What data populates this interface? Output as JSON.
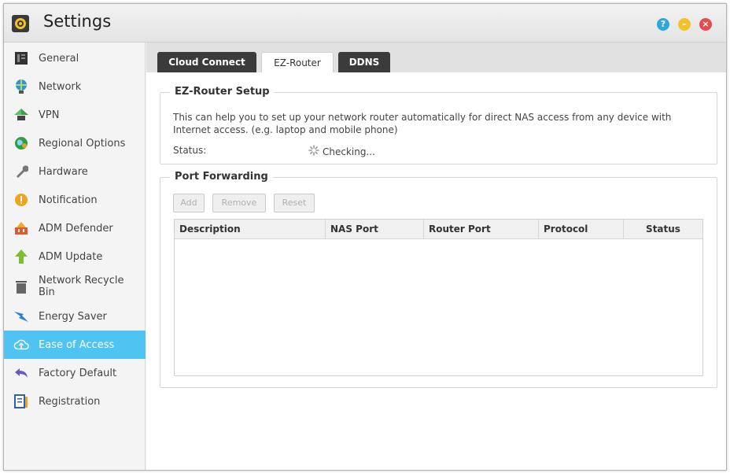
{
  "window": {
    "title": "Settings"
  },
  "window_controls": [
    "help",
    "minimize",
    "close"
  ],
  "sidebar": {
    "active_index": 10,
    "items": [
      {
        "label": "General",
        "icon": "general-icon"
      },
      {
        "label": "Network",
        "icon": "network-globe-icon"
      },
      {
        "label": "VPN",
        "icon": "vpn-icon"
      },
      {
        "label": "Regional Options",
        "icon": "regional-globe-icon"
      },
      {
        "label": "Hardware",
        "icon": "hardware-wrench-icon"
      },
      {
        "label": "Notification",
        "icon": "notification-icon"
      },
      {
        "label": "ADM Defender",
        "icon": "defender-icon"
      },
      {
        "label": "ADM Update",
        "icon": "update-arrow-icon"
      },
      {
        "label": "Network Recycle Bin",
        "icon": "recycle-bin-icon"
      },
      {
        "label": "Energy Saver",
        "icon": "energy-saver-icon"
      },
      {
        "label": "Ease of Access",
        "icon": "cloud-icon"
      },
      {
        "label": "Factory Default",
        "icon": "undo-arrow-icon"
      },
      {
        "label": "Registration",
        "icon": "registration-icon"
      }
    ]
  },
  "tabs": [
    {
      "label": "Cloud Connect"
    },
    {
      "label": "EZ-Router"
    },
    {
      "label": "DDNS"
    }
  ],
  "active_tab": "EZ-Router",
  "ez_router": {
    "legend": "EZ-Router Setup",
    "description": "This can help you to set up your network router automatically for direct NAS access from any device with Internet access. (e.g. laptop and mobile phone)",
    "status_label": "Status:",
    "status_value": "Checking..."
  },
  "port_forwarding": {
    "legend": "Port Forwarding",
    "buttons": {
      "add": "Add",
      "remove": "Remove",
      "reset": "Reset"
    },
    "columns": [
      "Description",
      "NAS Port",
      "Router Port",
      "Protocol",
      "Status"
    ],
    "rows": []
  },
  "colors": {
    "accent": "#4fc3f1",
    "tab_dark": "#3b3b3b",
    "help": "#2ea7dc",
    "minimize": "#f5c12a",
    "close": "#e74c4c"
  }
}
